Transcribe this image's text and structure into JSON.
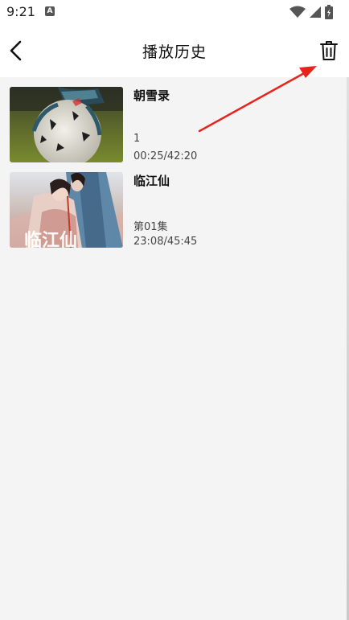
{
  "status_bar": {
    "time": "9:21",
    "notification_letter": "A",
    "icons": [
      "wifi-icon",
      "signal-icon",
      "battery-icon"
    ]
  },
  "header": {
    "title": "播放历史",
    "back_icon": "chevron-left-icon",
    "delete_icon": "trash-icon"
  },
  "history": [
    {
      "title": "朝雪录",
      "episode": "1",
      "progress": "00:25/42:20",
      "thumbnail": "soccer-ball-thumbnail"
    },
    {
      "title": "临江仙",
      "episode": "第01集",
      "progress": "23:08/45:45",
      "thumbnail": "drama-poster-thumbnail"
    }
  ],
  "colors": {
    "annotation_arrow": "#e8231c",
    "background": "#f4f4f4",
    "header_bg": "#ffffff"
  }
}
